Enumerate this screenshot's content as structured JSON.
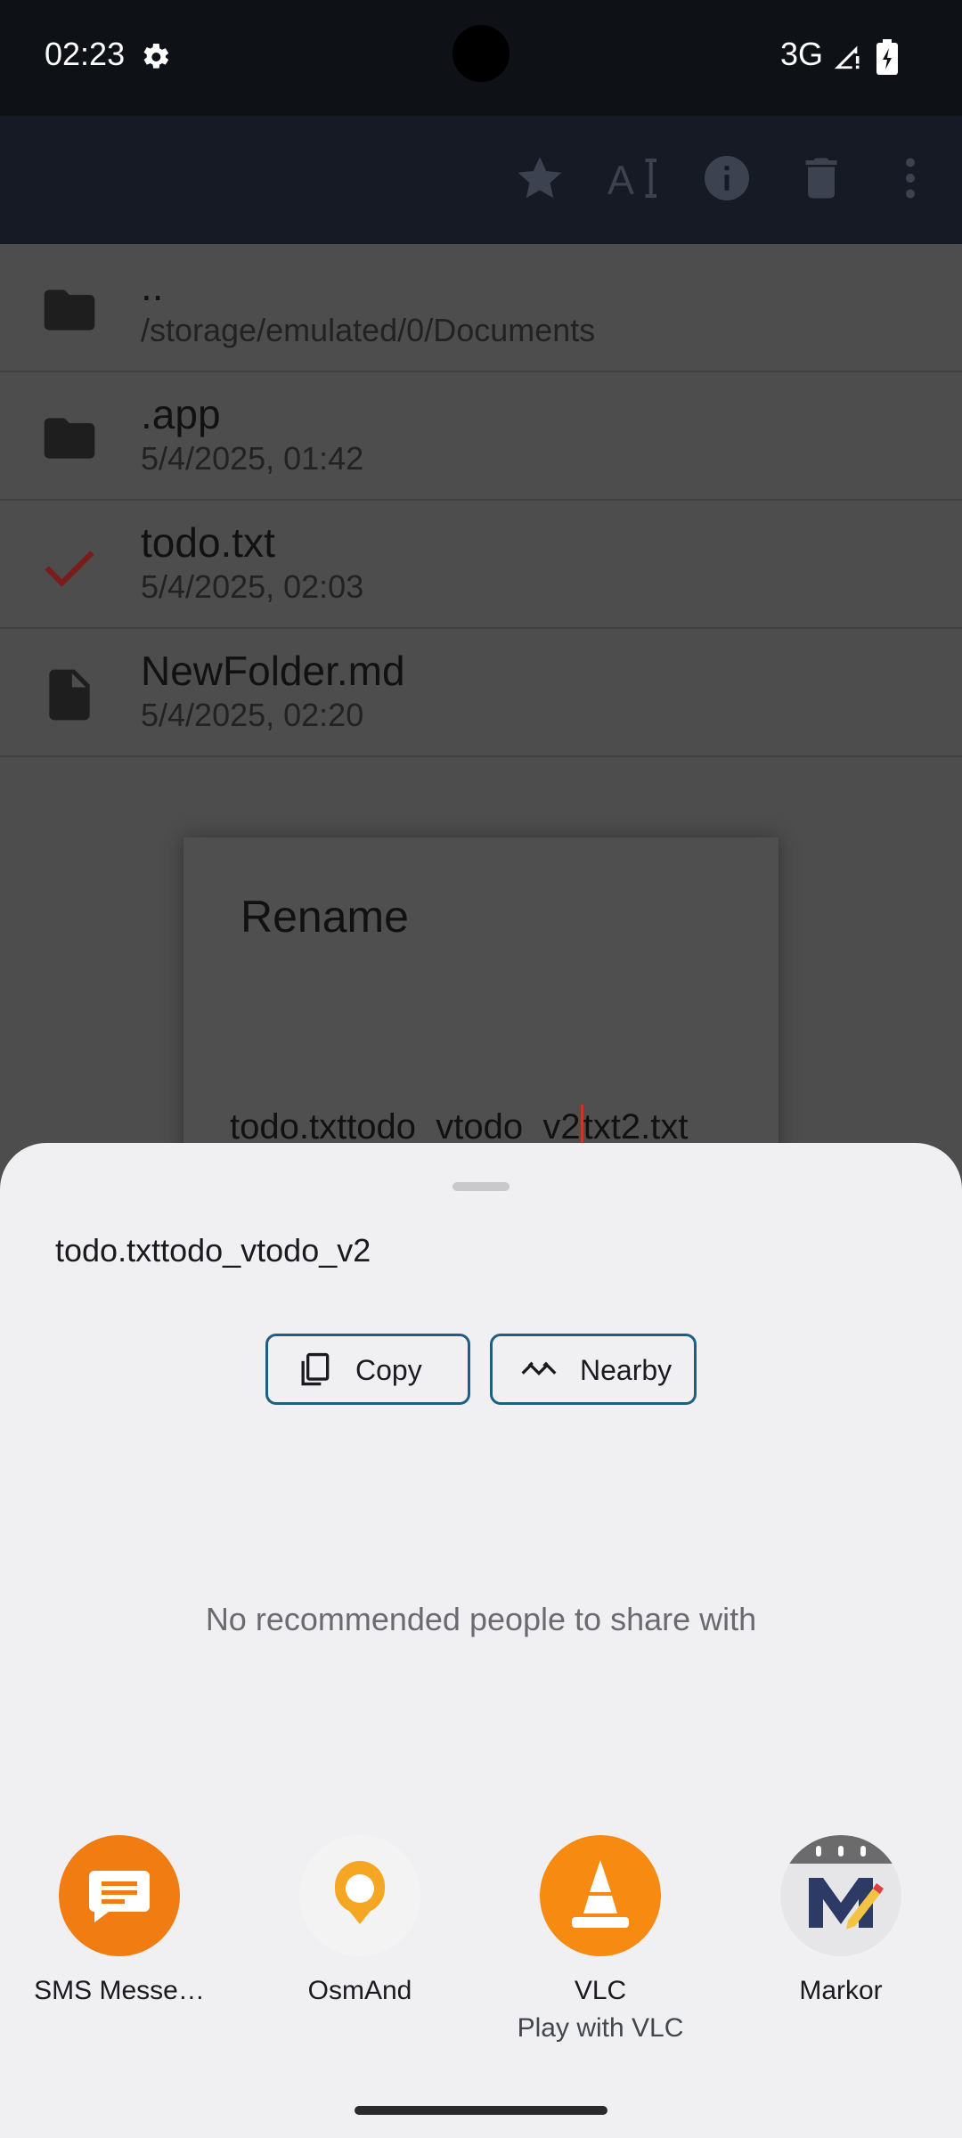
{
  "status_bar": {
    "time": "02:23",
    "network": "3G"
  },
  "toolbar": {
    "icons": [
      "star-icon",
      "text-format-icon",
      "info-icon",
      "delete-icon",
      "more-vert-icon"
    ]
  },
  "files": [
    {
      "name": "..",
      "meta": "/storage/emulated/0/Documents",
      "icon": "folder-icon"
    },
    {
      "name": ".app",
      "meta": "5/4/2025, 01:42",
      "icon": "folder-icon"
    },
    {
      "name": "todo.txt",
      "meta": "5/4/2025, 02:03",
      "icon": "check-icon"
    },
    {
      "name": "NewFolder.md",
      "meta": "5/4/2025, 02:20",
      "icon": "file-icon"
    }
  ],
  "rename_dialog": {
    "title": "Rename",
    "value_before_caret": "todo.txttodo_vtodo_v2",
    "value_after_caret": "txt2.txt"
  },
  "share_sheet": {
    "shared_text": "todo.txttodo_vtodo_v2",
    "copy_label": "Copy",
    "nearby_label": "Nearby",
    "no_people_text": "No recommended people to share with",
    "apps": [
      {
        "label": "SMS Messe…",
        "sub": "",
        "icon": "sms-app-icon"
      },
      {
        "label": "OsmAnd",
        "sub": "",
        "icon": "osmand-app-icon"
      },
      {
        "label": "VLC",
        "sub": "Play with VLC",
        "icon": "vlc-app-icon"
      },
      {
        "label": "Markor",
        "sub": "",
        "icon": "markor-app-icon"
      }
    ]
  },
  "colors": {
    "accent": "#1d5e82",
    "sms": "#f07c12",
    "vlc": "#f78a10",
    "osmand": "#f5a623"
  }
}
